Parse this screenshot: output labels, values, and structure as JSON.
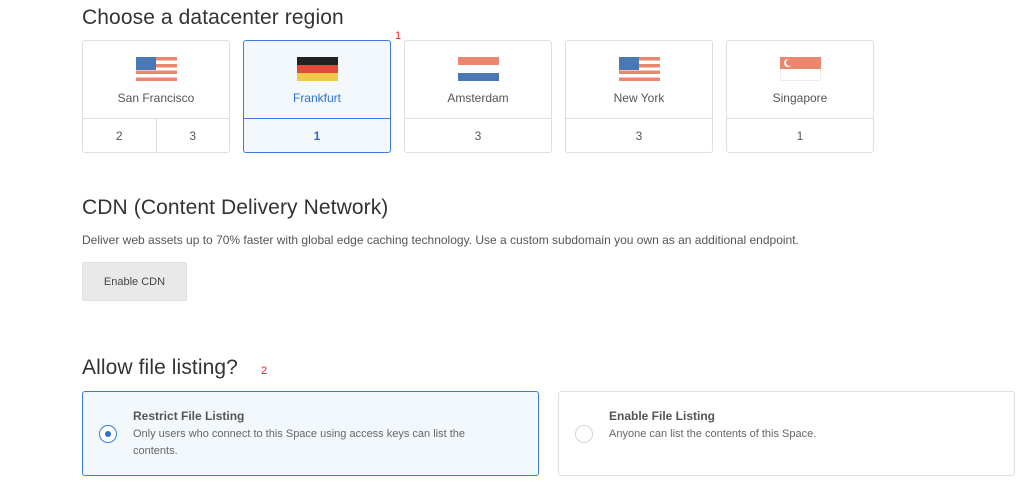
{
  "region_section": {
    "heading": "Choose a datacenter region",
    "annotation": "1",
    "regions": [
      {
        "name": "San Francisco",
        "flag": "us-flag-icon",
        "counts": [
          "2",
          "3"
        ],
        "selected": false
      },
      {
        "name": "Frankfurt",
        "flag": "germany-flag-icon",
        "counts": [
          "1"
        ],
        "selected": true
      },
      {
        "name": "Amsterdam",
        "flag": "netherlands-flag-icon",
        "counts": [
          "3"
        ],
        "selected": false
      },
      {
        "name": "New York",
        "flag": "us-flag-icon",
        "counts": [
          "3"
        ],
        "selected": false
      },
      {
        "name": "Singapore",
        "flag": "singapore-flag-icon",
        "counts": [
          "1"
        ],
        "selected": false
      }
    ]
  },
  "cdn_section": {
    "heading": "CDN (Content Delivery Network)",
    "description": "Deliver web assets up to 70% faster with global edge caching technology. Use a custom subdomain you own as an additional endpoint.",
    "button_label": "Enable CDN"
  },
  "listing_section": {
    "heading": "Allow file listing?",
    "annotation": "2",
    "options": [
      {
        "title": "Restrict File Listing",
        "line1": "Only users who connect to this Space using access keys can list the",
        "line2": "contents.",
        "selected": true
      },
      {
        "title": "Enable File Listing",
        "line1": "Anyone can list the contents of this Space.",
        "line2": "",
        "selected": false
      }
    ]
  },
  "colors": {
    "accent": "#3b7ddd",
    "selected_bg": "#f3f8fd",
    "annotation": "#dd2222",
    "flag_red": "#e9876f",
    "flag_blue": "#4a78b5"
  }
}
